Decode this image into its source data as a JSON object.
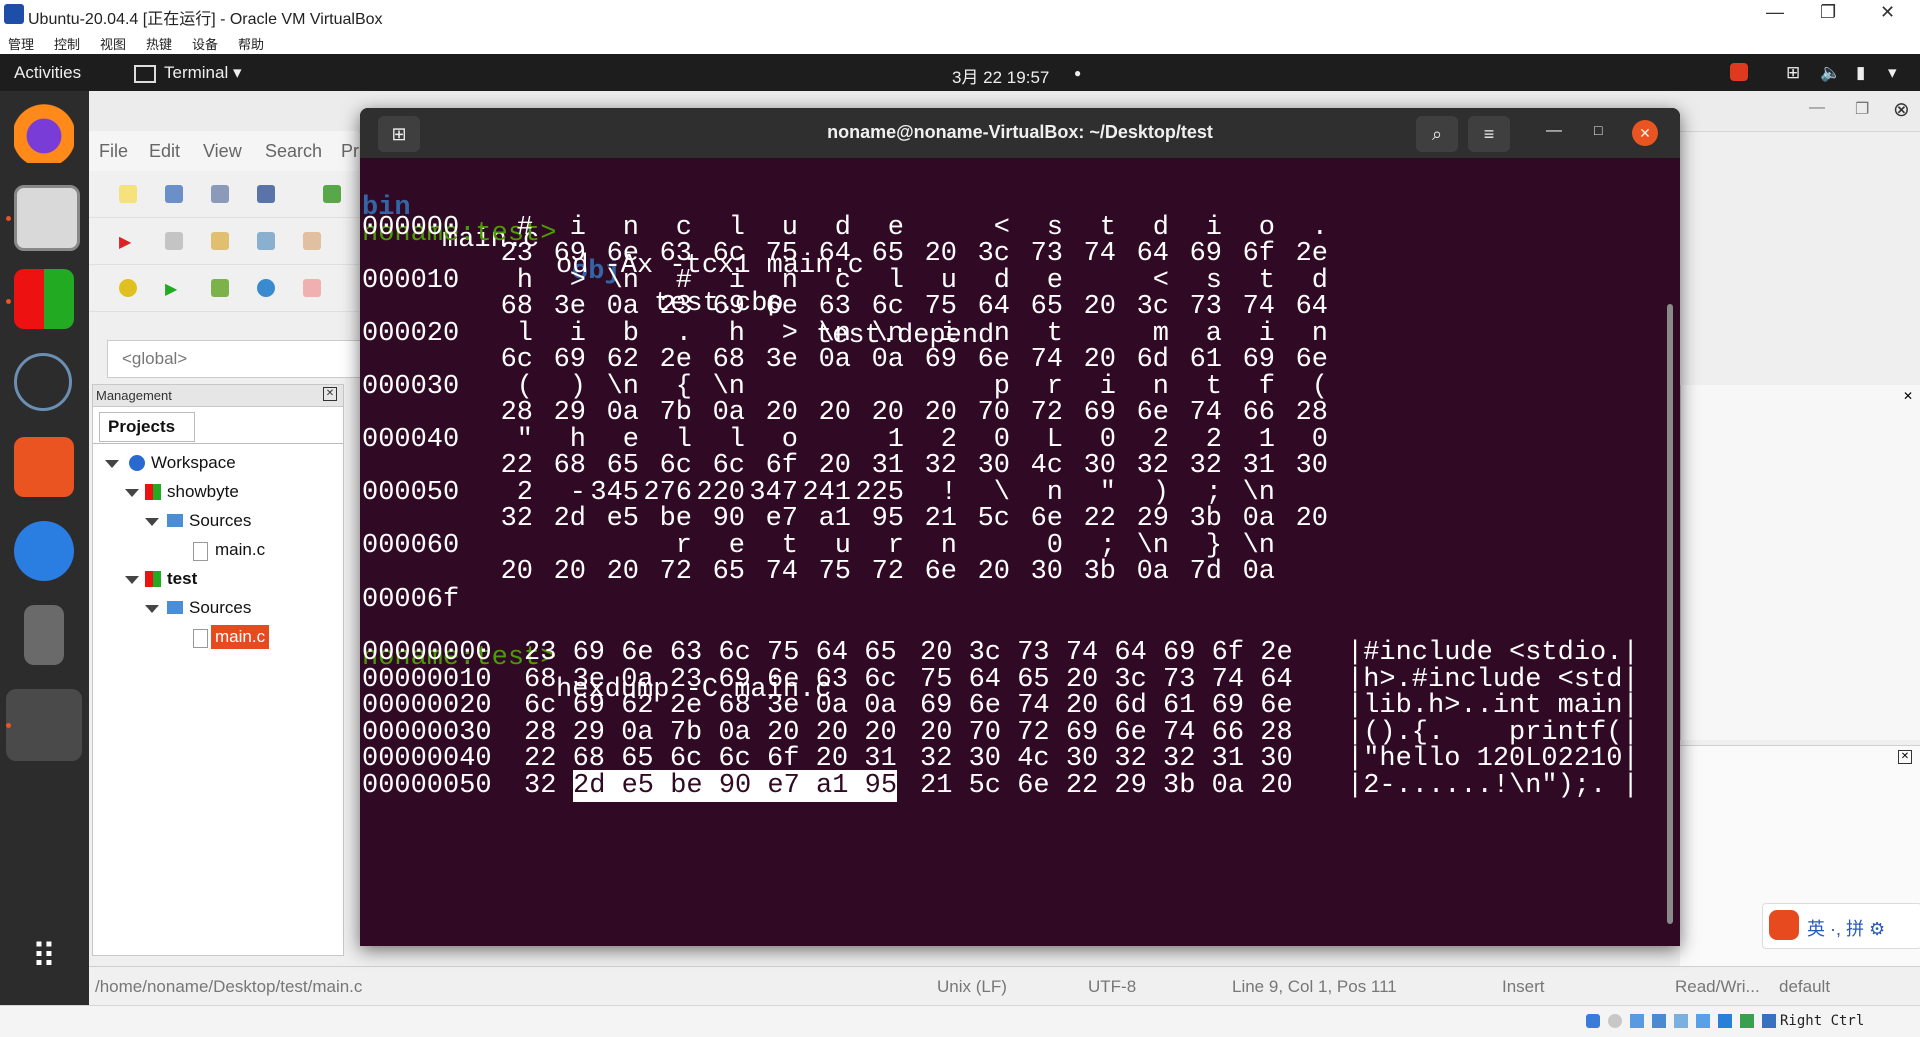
{
  "vbox": {
    "title": "Ubuntu-20.04.4 [正在运行] - Oracle VM VirtualBox",
    "menu": [
      "管理",
      "控制",
      "视图",
      "热键",
      "设备",
      "帮助"
    ],
    "min": "—",
    "restore": "❐",
    "close": "✕"
  },
  "topbar": {
    "activities": "Activities",
    "app": "Terminal ▾",
    "clock": "3月 22  19:57",
    "dot": "●"
  },
  "codeblocks": {
    "menu": [
      "File",
      "Edit",
      "View",
      "Search",
      "Pr"
    ],
    "global": "<global>",
    "management": "Management",
    "projects_tab": "Projects",
    "tree": [
      "Workspace",
      "showbyte",
      "Sources",
      "main.c",
      "test",
      "Sources",
      "main.c"
    ],
    "status": {
      "path": "/home/noname/Desktop/test/main.c",
      "eol": "Unix (LF)",
      "enc": "UTF-8",
      "pos": "Line 9, Col 1, Pos 111",
      "mode": "Insert",
      "rw": "Read/Wri...",
      "lang": "default"
    }
  },
  "terminal": {
    "title": "noname@noname-VirtualBox: ~/Desktop/test",
    "ls": {
      "bin": "bin",
      "main": "main.c",
      "obj": "obj",
      "cbp": "test.cbp",
      "depend": "test.depend"
    },
    "prompt": "noname:test>",
    "cmd1": "od -Ax -tcx1 main.c",
    "od": [
      {
        "off": "000000",
        "chars": [
          "#",
          "i",
          "n",
          "c",
          "l",
          "u",
          "d",
          "e",
          " ",
          "<",
          "s",
          "t",
          "d",
          "i",
          "o",
          "."
        ],
        "hex": [
          "23",
          "69",
          "6e",
          "63",
          "6c",
          "75",
          "64",
          "65",
          "20",
          "3c",
          "73",
          "74",
          "64",
          "69",
          "6f",
          "2e"
        ]
      },
      {
        "off": "000010",
        "chars": [
          "h",
          ">",
          "\\n",
          "#",
          "i",
          "n",
          "c",
          "l",
          "u",
          "d",
          "e",
          " ",
          "<",
          "s",
          "t",
          "d"
        ],
        "hex": [
          "68",
          "3e",
          "0a",
          "23",
          "69",
          "6e",
          "63",
          "6c",
          "75",
          "64",
          "65",
          "20",
          "3c",
          "73",
          "74",
          "64"
        ]
      },
      {
        "off": "000020",
        "chars": [
          "l",
          "i",
          "b",
          ".",
          "h",
          ">",
          "\\n",
          "\\n",
          "i",
          "n",
          "t",
          " ",
          "m",
          "a",
          "i",
          "n"
        ],
        "hex": [
          "6c",
          "69",
          "62",
          "2e",
          "68",
          "3e",
          "0a",
          "0a",
          "69",
          "6e",
          "74",
          "20",
          "6d",
          "61",
          "69",
          "6e"
        ]
      },
      {
        "off": "000030",
        "chars": [
          "(",
          ")",
          "\\n",
          "{",
          "\\n",
          " ",
          " ",
          " ",
          " ",
          "p",
          "r",
          "i",
          "n",
          "t",
          "f",
          "("
        ],
        "hex": [
          "28",
          "29",
          "0a",
          "7b",
          "0a",
          "20",
          "20",
          "20",
          "20",
          "70",
          "72",
          "69",
          "6e",
          "74",
          "66",
          "28"
        ]
      },
      {
        "off": "000040",
        "chars": [
          "\"",
          "h",
          "e",
          "l",
          "l",
          "o",
          " ",
          "1",
          "2",
          "0",
          "L",
          "0",
          "2",
          "2",
          "1",
          "0"
        ],
        "hex": [
          "22",
          "68",
          "65",
          "6c",
          "6c",
          "6f",
          "20",
          "31",
          "32",
          "30",
          "4c",
          "30",
          "32",
          "32",
          "31",
          "30"
        ]
      },
      {
        "off": "000050",
        "chars": [
          "2",
          "-",
          "345",
          "276",
          "220",
          "347",
          "241",
          "225",
          "!",
          "\\",
          "n",
          "\"",
          ")",
          ";",
          "\\n",
          ""
        ],
        "hex": [
          "32",
          "2d",
          "e5",
          "be",
          "90",
          "e7",
          "a1",
          "95",
          "21",
          "5c",
          "6e",
          "22",
          "29",
          "3b",
          "0a",
          "20"
        ]
      },
      {
        "off": "000060",
        "chars": [
          " ",
          " ",
          " ",
          "r",
          "e",
          "t",
          "u",
          "r",
          "n",
          " ",
          "0",
          ";",
          "\\n",
          "}",
          "\\n",
          ""
        ],
        "hex": [
          "20",
          "20",
          "20",
          "72",
          "65",
          "74",
          "75",
          "72",
          "6e",
          "20",
          "30",
          "3b",
          "0a",
          "7d",
          "0a",
          ""
        ]
      }
    ],
    "od_end": "00006f",
    "cmd2": "hexdump -C main.c",
    "hd": [
      {
        "off": "00000000",
        "a": "23 69 6e 63 6c 75 64 65",
        "b": "20 3c 73 74 64 69 6f 2e",
        "asc": "|#include <stdio.|"
      },
      {
        "off": "00000010",
        "a": "68 3e 0a 23 69 6e 63 6c",
        "b": "75 64 65 20 3c 73 74 64",
        "asc": "|h>.#include <std|"
      },
      {
        "off": "00000020",
        "a": "6c 69 62 2e 68 3e 0a 0a",
        "b": "69 6e 74 20 6d 61 69 6e",
        "asc": "|lib.h>..int main|"
      },
      {
        "off": "00000030",
        "a": "28 29 0a 7b 0a 20 20 20",
        "b": "20 70 72 69 6e 74 66 28",
        "asc": "|().{.    printf(|"
      },
      {
        "off": "00000040",
        "a": "22 68 65 6c 6c 6f 20 31",
        "b": "32 30 4c 30 32 32 31 30",
        "asc": "|\"hello 120L02210|"
      },
      {
        "off": "00000050",
        "a0": "32",
        "a_hl": "2d e5 be 90 e7 a1 95",
        "b": "21 5c 6e 22 29 3b 0a 20",
        "asc": "|2-......!\\n\");. |"
      }
    ]
  },
  "vbox_status": {
    "hostkey": "Right Ctrl"
  },
  "ime": {
    "label": "英 ·, 拼 ⚙"
  }
}
